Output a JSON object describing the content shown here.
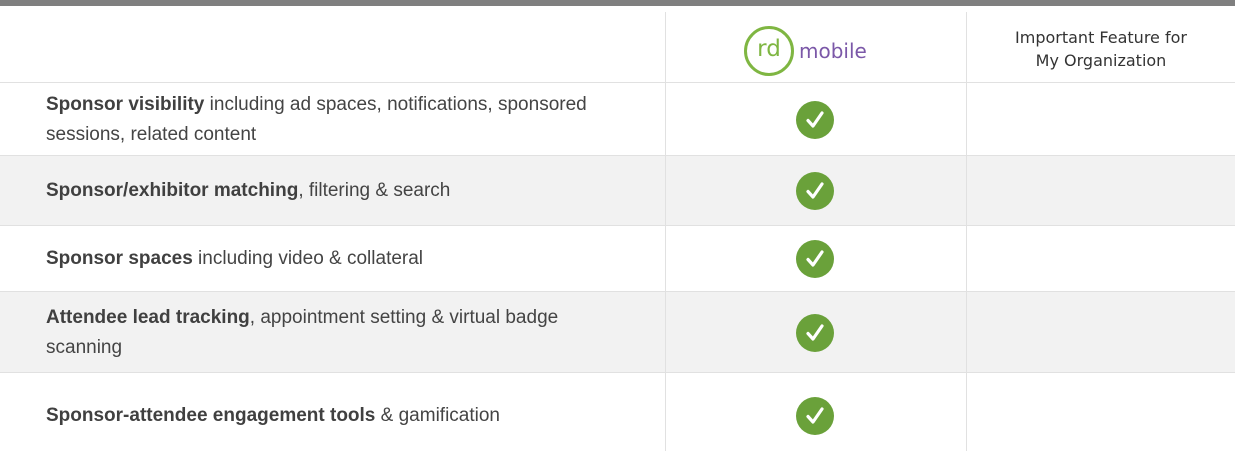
{
  "header": {
    "logo": {
      "rd": "rd",
      "mobile": "mobile"
    },
    "important_label": "Important Feature for My Organization"
  },
  "colors": {
    "check_green": "#6aa13a",
    "logo_green": "#7fb642",
    "logo_purple": "#7b58a8",
    "alt_row": "#f2f2f2"
  },
  "rows": [
    {
      "bold": "Sponsor visibility",
      "rest": " including ad spaces, notifications, sponsored sessions, related content",
      "supported": true
    },
    {
      "bold": "Sponsor/exhibitor matching",
      "rest": ", filtering & search",
      "supported": true
    },
    {
      "bold": "Sponsor spaces",
      "rest": " including video & collateral",
      "supported": true
    },
    {
      "bold": "Attendee lead tracking",
      "rest": ", appointment setting & virtual badge scanning",
      "supported": true
    },
    {
      "bold": "Sponsor-attendee engagement tools",
      "rest": " & gamification",
      "supported": true
    }
  ]
}
